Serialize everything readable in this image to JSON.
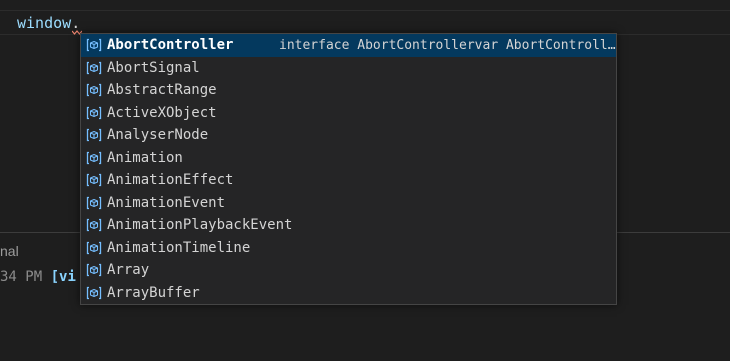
{
  "editor": {
    "code_identifier": "window",
    "code_dot": "."
  },
  "panel": {
    "title": "nal",
    "terminal_time": "34 PM",
    "terminal_tag": "[vi"
  },
  "suggest": {
    "icon": "variable-icon",
    "accent_color": "#75beff",
    "selected_detail": "interface AbortControllervar AbortController: { new (): AbortController; prototype: AbortController; }",
    "items": [
      {
        "label": "AbortController"
      },
      {
        "label": "AbortSignal"
      },
      {
        "label": "AbstractRange"
      },
      {
        "label": "ActiveXObject"
      },
      {
        "label": "AnalyserNode"
      },
      {
        "label": "Animation"
      },
      {
        "label": "AnimationEffect"
      },
      {
        "label": "AnimationEvent"
      },
      {
        "label": "AnimationPlaybackEvent"
      },
      {
        "label": "AnimationTimeline"
      },
      {
        "label": "Array"
      },
      {
        "label": "ArrayBuffer"
      }
    ]
  }
}
